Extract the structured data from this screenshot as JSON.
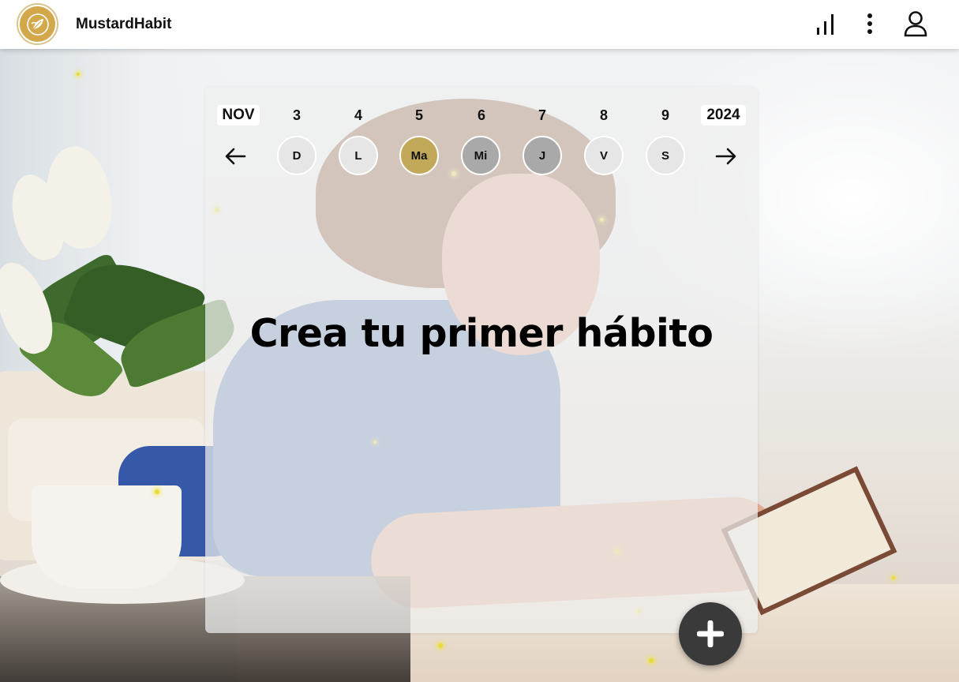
{
  "app": {
    "name": "MustardHabit"
  },
  "header": {
    "icons": [
      "stats-icon",
      "more-vert-icon",
      "account-icon"
    ]
  },
  "calendar": {
    "month": "NOV",
    "year": "2024",
    "days": [
      {
        "number": "3",
        "letter": "D",
        "state": "default"
      },
      {
        "number": "4",
        "letter": "L",
        "state": "default"
      },
      {
        "number": "5",
        "letter": "Ma",
        "state": "today"
      },
      {
        "number": "6",
        "letter": "Mi",
        "state": "past"
      },
      {
        "number": "7",
        "letter": "J",
        "state": "past"
      },
      {
        "number": "8",
        "letter": "V",
        "state": "default"
      },
      {
        "number": "9",
        "letter": "S",
        "state": "default"
      }
    ]
  },
  "main": {
    "empty_title": "Crea tu primer hábito"
  },
  "colors": {
    "accent": "#d2a84a",
    "today_fill": "#c2a859",
    "past_fill": "#a9a9a9",
    "default_fill": "#e6e6e6",
    "fab": "#3a3a3a",
    "sparkle": "#e8dc3a"
  }
}
